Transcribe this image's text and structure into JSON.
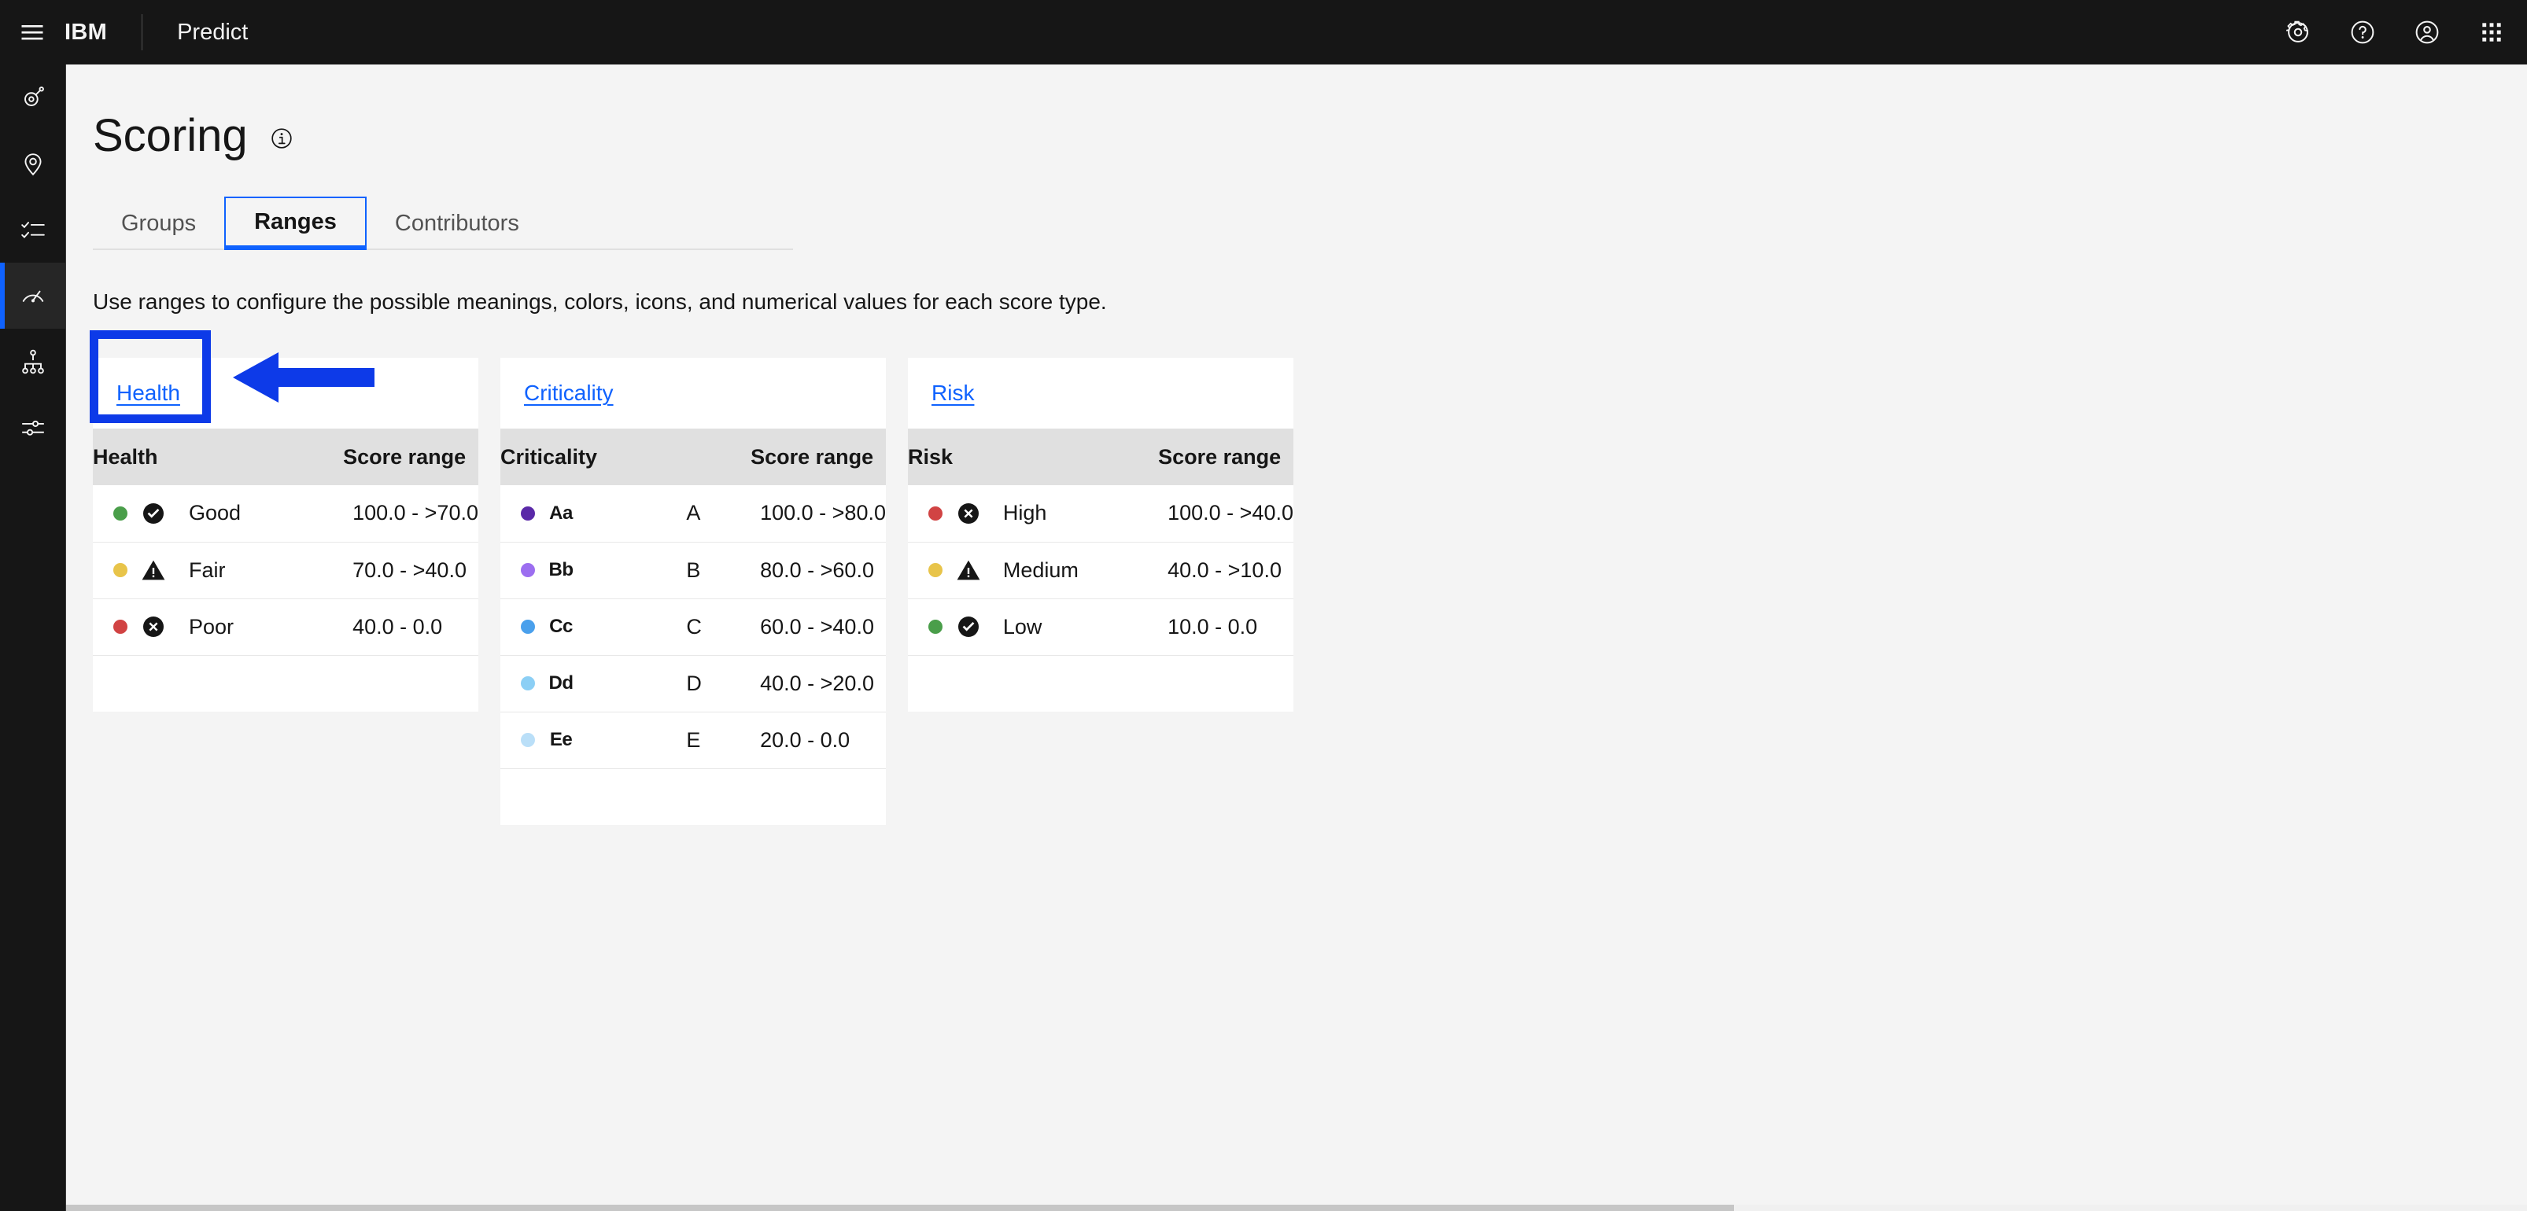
{
  "header": {
    "menu_icon": "hamburger-menu-icon",
    "brand": "IBM",
    "product": "Predict",
    "actions": [
      {
        "name": "settings-icon",
        "label": "Settings"
      },
      {
        "name": "help-icon",
        "label": "Help"
      },
      {
        "name": "user-avatar-icon",
        "label": "Profile"
      },
      {
        "name": "app-switcher-icon",
        "label": "Switcher"
      }
    ]
  },
  "sidebar": {
    "items": [
      {
        "name": "asset-icon",
        "active": false
      },
      {
        "name": "location-pin-icon",
        "active": false
      },
      {
        "name": "checklist-icon",
        "active": false
      },
      {
        "name": "gauge-icon",
        "active": true
      },
      {
        "name": "hierarchy-icon",
        "active": false
      },
      {
        "name": "sliders-icon",
        "active": false
      }
    ]
  },
  "page": {
    "title": "Scoring",
    "info_icon": "information-icon",
    "description": "Use ranges to configure the possible meanings, colors, icons, and numerical values for each score type."
  },
  "tabs": [
    {
      "label": "Groups",
      "selected": false
    },
    {
      "label": "Ranges",
      "selected": true
    },
    {
      "label": "Contributors",
      "selected": false
    }
  ],
  "cards": [
    {
      "link_label": "Health",
      "col_label": "Health",
      "col_range": "Score range",
      "has_abbrev": false,
      "rows": [
        {
          "dot": "#4a9e4a",
          "icon": "check-circle-filled-icon",
          "meaning": "Good",
          "abbrev": "",
          "range": "100.0 - >70.0"
        },
        {
          "dot": "#e8c44a",
          "icon": "warning-triangle-filled-icon",
          "meaning": "Fair",
          "abbrev": "",
          "range": "70.0 - >40.0"
        },
        {
          "dot": "#d14343",
          "icon": "error-x-circle-filled-icon",
          "meaning": "Poor",
          "abbrev": "",
          "range": "40.0 - 0.0"
        }
      ]
    },
    {
      "link_label": "Criticality",
      "col_label": "Criticality",
      "col_range": "Score range",
      "has_abbrev": true,
      "rows": [
        {
          "dot": "#5a29a8",
          "icon": "letter-Aa-icon",
          "glyph": "Aa",
          "meaning": "",
          "abbrev": "A",
          "range": "100.0 - >80.0"
        },
        {
          "dot": "#9c6ef0",
          "icon": "letter-Bb-icon",
          "glyph": "Bb",
          "meaning": "",
          "abbrev": "B",
          "range": "80.0 - >60.0"
        },
        {
          "dot": "#4aa0ec",
          "icon": "letter-Cc-icon",
          "glyph": "Cc",
          "meaning": "",
          "abbrev": "C",
          "range": "60.0 - >40.0"
        },
        {
          "dot": "#8ccff5",
          "icon": "letter-Dd-icon",
          "glyph": "Dd",
          "meaning": "",
          "abbrev": "D",
          "range": "40.0 - >20.0"
        },
        {
          "dot": "#badff8",
          "icon": "letter-Ee-icon",
          "glyph": "Ee",
          "meaning": "",
          "abbrev": "E",
          "range": "20.0 - 0.0"
        }
      ]
    },
    {
      "link_label": "Risk",
      "col_label": "Risk",
      "col_range": "Score range",
      "has_abbrev": false,
      "rows": [
        {
          "dot": "#d14343",
          "icon": "error-x-circle-filled-icon",
          "meaning": "High",
          "abbrev": "",
          "range": "100.0 - >40.0"
        },
        {
          "dot": "#e8c44a",
          "icon": "warning-triangle-filled-icon",
          "meaning": "Medium",
          "abbrev": "",
          "range": "40.0 - >10.0"
        },
        {
          "dot": "#4a9e4a",
          "icon": "check-circle-filled-icon",
          "meaning": "Low",
          "abbrev": "",
          "range": "10.0 - 0.0"
        }
      ]
    }
  ],
  "annotation": {
    "highlight_color": "#0d3ae8",
    "arrow_color": "#0d3ae8",
    "target": "Health"
  },
  "colors": {
    "header_bg": "#161616",
    "page_bg": "#f4f4f4",
    "card_bg": "#ffffff",
    "table_header_bg": "#e0e0e0",
    "accent_blue": "#0f62fe"
  }
}
